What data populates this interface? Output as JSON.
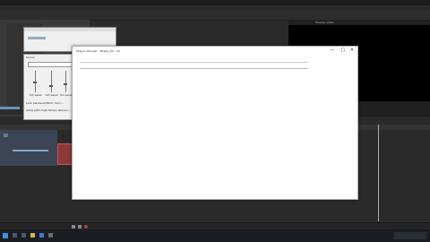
{
  "plugin_window": {
    "title": "Plug-In Chooser - Empty_20... 07",
    "minimize": "—",
    "maximize": "□",
    "close": "✕"
  },
  "dialog": {
    "title": "Sound",
    "slider_labels": [
      "Sin Level",
      "Sin Level",
      "Sin Level"
    ],
    "check1": "Lock pan/level Pitch, mic=...",
    "check2": "Allow pitch high Tempo  above=..."
  },
  "preview_panel": {
    "tab": "Preview Video"
  },
  "colors": {
    "clip": "#8b3a3a",
    "track_header": "#3b4555",
    "taskbar": "#1a1d22"
  },
  "icons": [
    "windows-start-icon",
    "search-icon",
    "task-view-icon",
    "explorer-icon",
    "browser-icon",
    "app-icon"
  ]
}
